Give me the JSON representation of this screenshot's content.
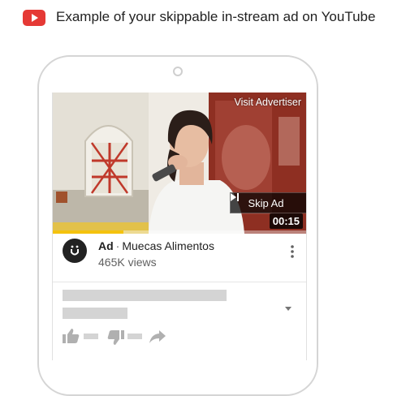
{
  "header": {
    "logo_icon": "youtube-play-icon",
    "logo_color": "#e53935",
    "title": "Example of your skippable in-stream ad on YouTube"
  },
  "video": {
    "visit_advertiser_label": "Visit Advertiser",
    "skip_ad_label": "Skip Ad",
    "skip_icon": "skip-next-icon",
    "duration": "00:15",
    "progress_fraction": 0.28,
    "progress_color": "#f4c20d"
  },
  "ad": {
    "badge": "Ad",
    "separator": "·",
    "advertiser": "Muecas Alimentos",
    "views": "465K views",
    "avatar_icon": "advertiser-logo-icon",
    "more_icon": "more-vert-icon"
  },
  "placeholders": {
    "expand_icon": "chevron-down-icon",
    "like_icon": "thumb-up-icon",
    "dislike_icon": "thumb-down-icon",
    "share_icon": "share-icon"
  }
}
